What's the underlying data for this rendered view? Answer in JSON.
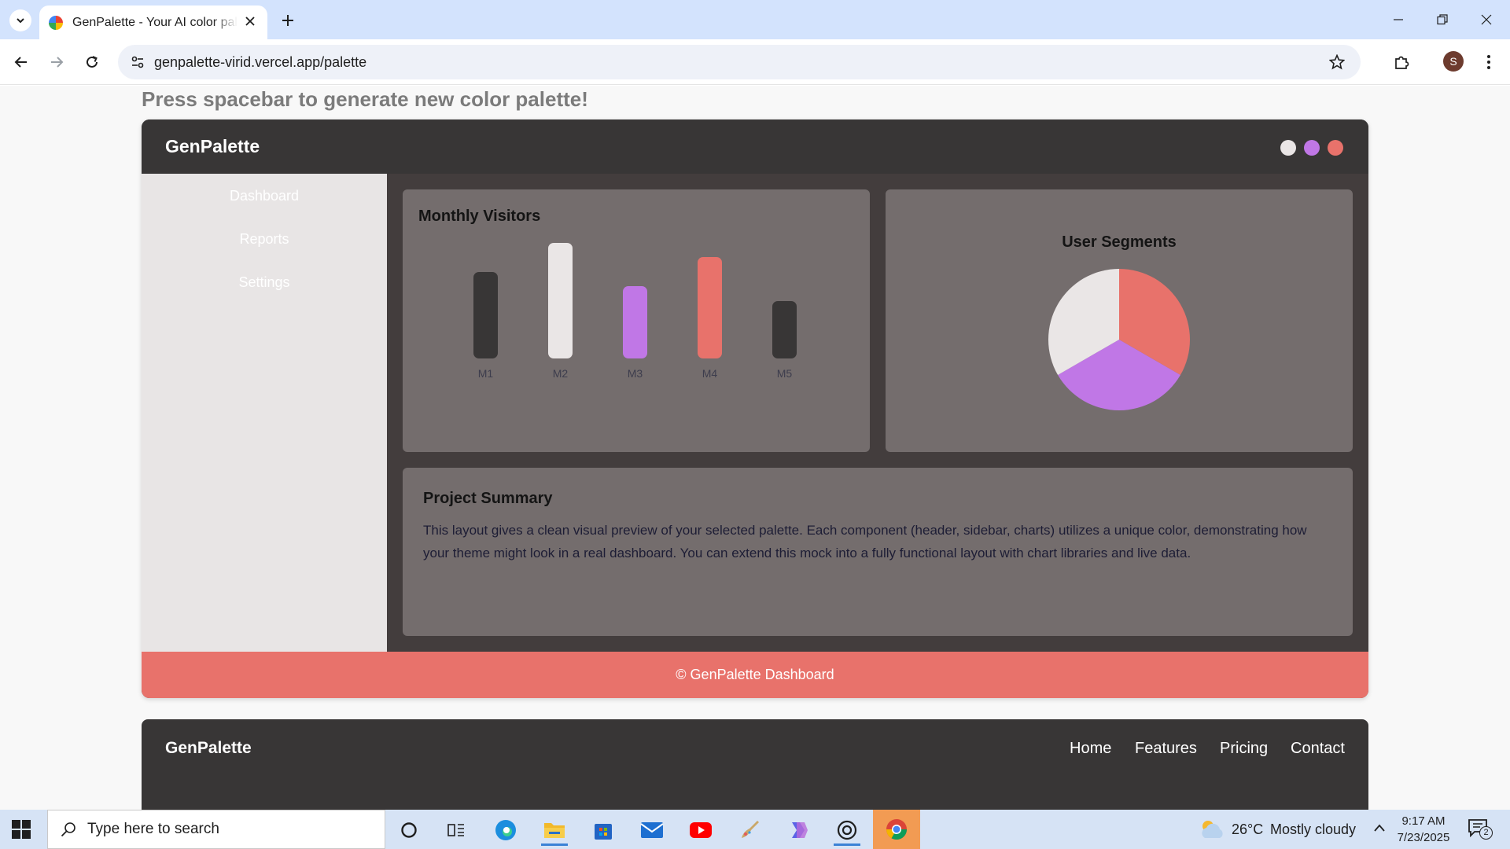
{
  "browser": {
    "tab_title": "GenPalette - Your AI color palette",
    "url": "genpalette-virid.vercel.app/palette",
    "profile_initial": "S"
  },
  "page": {
    "hint": "Press spacebar to generate new color palette!"
  },
  "dashboard": {
    "brand": "GenPalette",
    "palette_dots": [
      "#eae6e6",
      "#c077e6",
      "#e8726b"
    ],
    "sidebar": [
      {
        "label": "Dashboard"
      },
      {
        "label": "Reports"
      },
      {
        "label": "Settings"
      }
    ],
    "monthly_visitors": {
      "title": "Monthly Visitors"
    },
    "user_segments": {
      "title": "User Segments"
    },
    "summary": {
      "title": "Project Summary",
      "text": "This layout gives a clean visual preview of your selected palette. Each component (header, sidebar, charts) utilizes a unique color, demonstrating how your theme might look in a real dashboard. You can extend this mock into a fully functional layout with chart libraries and live data."
    },
    "footer": "© GenPalette Dashboard"
  },
  "chart_data": [
    {
      "type": "bar",
      "title": "Monthly Visitors",
      "categories": [
        "M1",
        "M2",
        "M3",
        "M4",
        "M5"
      ],
      "values": [
        60,
        80,
        50,
        70,
        40
      ],
      "colors": [
        "#383636",
        "#eae6e6",
        "#c077e6",
        "#e8726b",
        "#383636"
      ]
    },
    {
      "type": "pie",
      "title": "User Segments",
      "labels": [],
      "values": [
        33.3,
        33.3,
        33.3
      ],
      "colors": [
        "#e8726b",
        "#c077e6",
        "#eae6e6"
      ]
    }
  ],
  "site_footer": {
    "brand": "GenPalette",
    "links": [
      "Home",
      "Features",
      "Pricing",
      "Contact"
    ]
  },
  "taskbar": {
    "search_placeholder": "Type here to search",
    "weather_temp": "26°C",
    "weather_desc": "Mostly cloudy",
    "time": "9:17 AM",
    "date": "7/23/2025",
    "notification_count": "2"
  }
}
